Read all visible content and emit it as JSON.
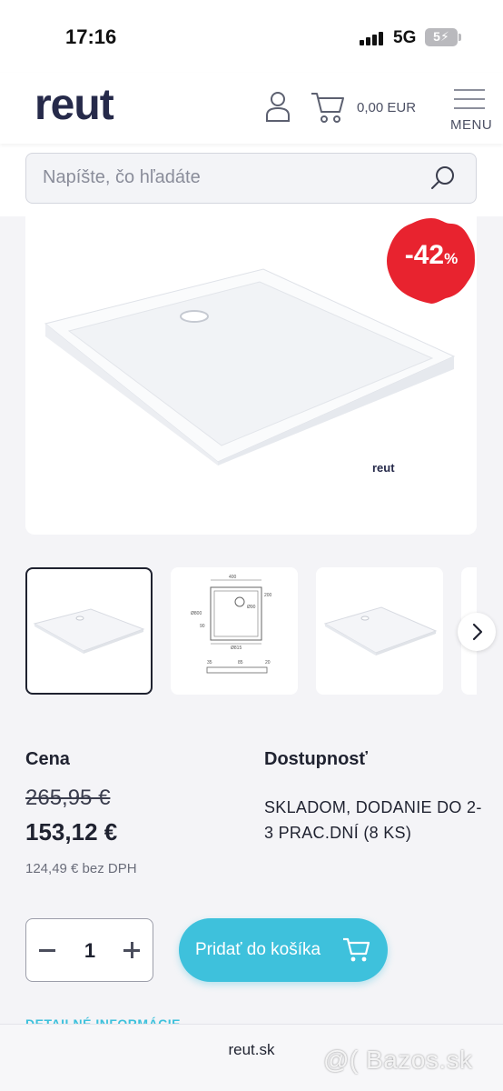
{
  "status_bar": {
    "time": "17:16",
    "network": "5G",
    "battery": "5"
  },
  "header": {
    "logo": "reut",
    "cart_total": "0,00 EUR",
    "menu_label": "MENU",
    "icons": {
      "user": "user-icon",
      "cart": "cart-icon",
      "menu": "hamburger-icon"
    }
  },
  "search": {
    "placeholder": "Napíšte, čo hľadáte"
  },
  "product": {
    "discount_value": "-42",
    "discount_unit": "%",
    "image_watermark": "reut",
    "price_label": "Cena",
    "old_price": "265,95 €",
    "new_price": "153,12 €",
    "net_price": "124,49 € bez DPH",
    "availability_label": "Dostupnosť",
    "availability_value": "SKLADOM, DODANIE DO 2-3 PRAC.DNÍ (8 KS)",
    "quantity": "1",
    "add_to_cart_label": "Pridať do košíka",
    "details_link": "DETAILNÉ INFORMÁCIE",
    "drawing_dims": [
      "400",
      "200",
      "Ø90",
      "Ø800",
      "90",
      "Ø815",
      "35",
      "85",
      "20"
    ]
  },
  "browser": {
    "url": "reut.sk"
  },
  "watermark": "@( Bazos.sk",
  "colors": {
    "accent": "#3ec1dc",
    "discount": "#e8232f",
    "brand": "#262a4a"
  }
}
